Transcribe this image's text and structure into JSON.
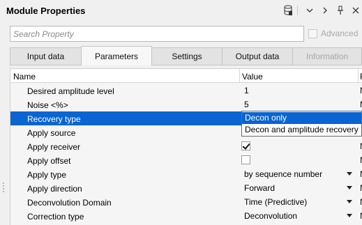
{
  "window": {
    "title": "Module Properties",
    "icons": [
      "database-icon",
      "chevron-down-icon",
      "chevron-right-icon",
      "pin-icon",
      "close-icon"
    ]
  },
  "search": {
    "placeholder": "Search Property",
    "value": ""
  },
  "advanced": {
    "label": "Advanced",
    "checked": false,
    "enabled": false
  },
  "tabs": [
    {
      "label": "Input data",
      "active": false,
      "enabled": true
    },
    {
      "label": "Parameters",
      "active": true,
      "enabled": true
    },
    {
      "label": "Settings",
      "active": false,
      "enabled": true
    },
    {
      "label": "Output data",
      "active": false,
      "enabled": true
    },
    {
      "label": "Information",
      "active": false,
      "enabled": false
    }
  ],
  "grid": {
    "columns": {
      "name": "Name",
      "value": "Value",
      "third": "R"
    },
    "rows": [
      {
        "name": "Desired amplitude level",
        "value": "1",
        "cut": "N"
      },
      {
        "name": "Noise <%>",
        "value": "5",
        "cut": "N"
      },
      {
        "name": "Recovery type",
        "value": "",
        "cut": "N",
        "selected": true
      },
      {
        "name": "Apply source",
        "value": "",
        "cut": "N"
      },
      {
        "name": "Apply receiver",
        "value": "",
        "cut": "N",
        "checkbox": true,
        "checked": true
      },
      {
        "name": "Apply offset",
        "value": "",
        "cut": "N",
        "checkbox": true,
        "checked": false
      },
      {
        "name": "Apply type",
        "value": "by sequence number",
        "cut": "N",
        "dropdown": true
      },
      {
        "name": "Apply direction",
        "value": "Forward",
        "cut": "N",
        "dropdown": true
      },
      {
        "name": "Deconvolution Domain",
        "value": "Time (Predictive)",
        "cut": "N",
        "dropdown": true
      },
      {
        "name": "Correction type",
        "value": "Deconvolution",
        "cut": "N",
        "dropdown": true
      }
    ]
  },
  "dropdown_open": {
    "options": [
      "Decon only",
      "Decon and amplitude recovery"
    ],
    "highlighted_index": 0
  },
  "colors": {
    "selection": "#0a64d2",
    "background": "#f0f0f0"
  }
}
